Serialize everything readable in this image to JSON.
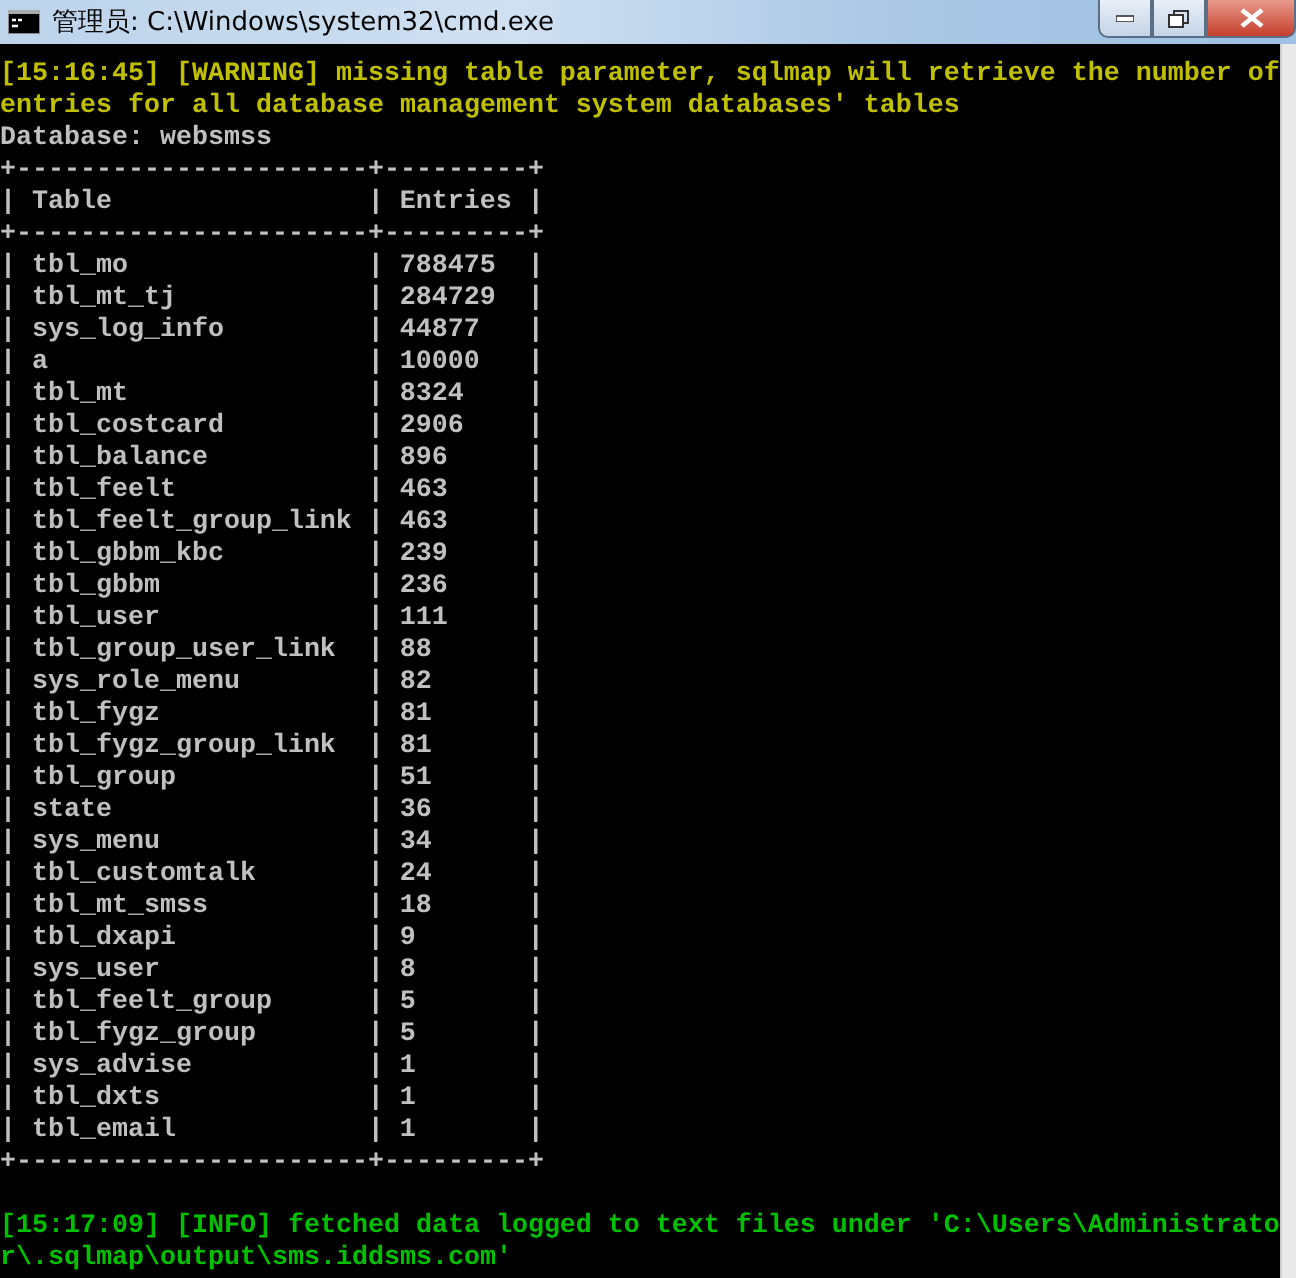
{
  "window": {
    "title": "管理员: C:\\Windows\\system32\\cmd.exe"
  },
  "console": [
    {
      "kind": "warning",
      "text": "[15:16:45] [WARNING] missing table parameter, sqlmap will retrieve the number of entries for all database management system databases' tables"
    },
    {
      "kind": "plain",
      "text": "Database: websmss"
    },
    {
      "kind": "table",
      "top_border": "+----------------------+---------+",
      "header_border": "+----------------------+---------+",
      "bottom_border": "+----------------------+---------+",
      "separator": "|",
      "columns": [
        "Table",
        "Entries"
      ],
      "rows": [
        [
          "tbl_mo",
          "788475"
        ],
        [
          "tbl_mt_tj",
          "284729"
        ],
        [
          "sys_log_info",
          "44877"
        ],
        [
          "a",
          "10000"
        ],
        [
          "tbl_mt",
          "8324"
        ],
        [
          "tbl_costcard",
          "2906"
        ],
        [
          "tbl_balance",
          "896"
        ],
        [
          "tbl_feelt",
          "463"
        ],
        [
          "tbl_feelt_group_link",
          "463"
        ],
        [
          "tbl_gbbm_kbc",
          "239"
        ],
        [
          "tbl_gbbm",
          "236"
        ],
        [
          "tbl_user",
          "111"
        ],
        [
          "tbl_group_user_link",
          "88"
        ],
        [
          "sys_role_menu",
          "82"
        ],
        [
          "tbl_fygz",
          "81"
        ],
        [
          "tbl_fygz_group_link",
          "81"
        ],
        [
          "tbl_group",
          "51"
        ],
        [
          "state",
          "36"
        ],
        [
          "sys_menu",
          "34"
        ],
        [
          "tbl_customtalk",
          "24"
        ],
        [
          "tbl_mt_smss",
          "18"
        ],
        [
          "tbl_dxapi",
          "9"
        ],
        [
          "sys_user",
          "8"
        ],
        [
          "tbl_feelt_group",
          "5"
        ],
        [
          "tbl_fygz_group",
          "5"
        ],
        [
          "sys_advise",
          "1"
        ],
        [
          "tbl_dxts",
          "1"
        ],
        [
          "tbl_email",
          "1"
        ]
      ]
    },
    {
      "kind": "info",
      "text": "[15:17:09] [INFO] fetched data logged to text files under 'C:\\Users\\Administrator\\.sqlmap\\output\\sms.iddsms.com'"
    }
  ]
}
